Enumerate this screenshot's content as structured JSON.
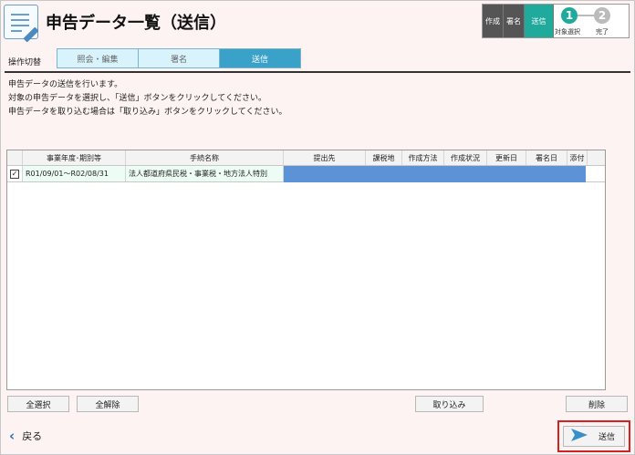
{
  "header": {
    "title": "申告データ一覧（送信）",
    "steps": {
      "tabs": [
        "作成",
        "署名",
        "送信"
      ],
      "active_tab": "送信",
      "progress": [
        {
          "number": "1",
          "label": "対象選択"
        },
        {
          "number": "2",
          "label": "完了"
        }
      ]
    }
  },
  "mode_switch": {
    "label": "操作切替",
    "tabs": [
      "照会・編集",
      "署名",
      "送信"
    ],
    "active": "送信"
  },
  "instructions": [
    "申告データの送信を行います。",
    "対象の申告データを選択し、「送信」ボタンをクリックしてください。",
    "申告データを取り込む場合は「取り込み」ボタンをクリックしてください。"
  ],
  "table": {
    "columns": [
      "事業年度･期別等",
      "手続名称",
      "提出先",
      "課税地",
      "作成方法",
      "作成状況",
      "更新日",
      "署名日",
      "添付"
    ],
    "rows": [
      {
        "checked": true,
        "period": "R01/09/01～R02/08/31",
        "procedure": "法人都道府県民税・事業税・地方法人特別",
        "submit_to": "",
        "tax_location": "",
        "method": "",
        "status": "",
        "updated": "",
        "signed": "",
        "attachment": ""
      }
    ]
  },
  "buttons": {
    "select_all": "全選択",
    "deselect_all": "全解除",
    "import": "取り込み",
    "delete": "削除",
    "back": "戻る",
    "send": "送信"
  },
  "colors": {
    "accent": "#1faa9c",
    "active_tab": "#3aa2c9",
    "selection": "#5b93d6",
    "highlight_border": "#d32020"
  }
}
